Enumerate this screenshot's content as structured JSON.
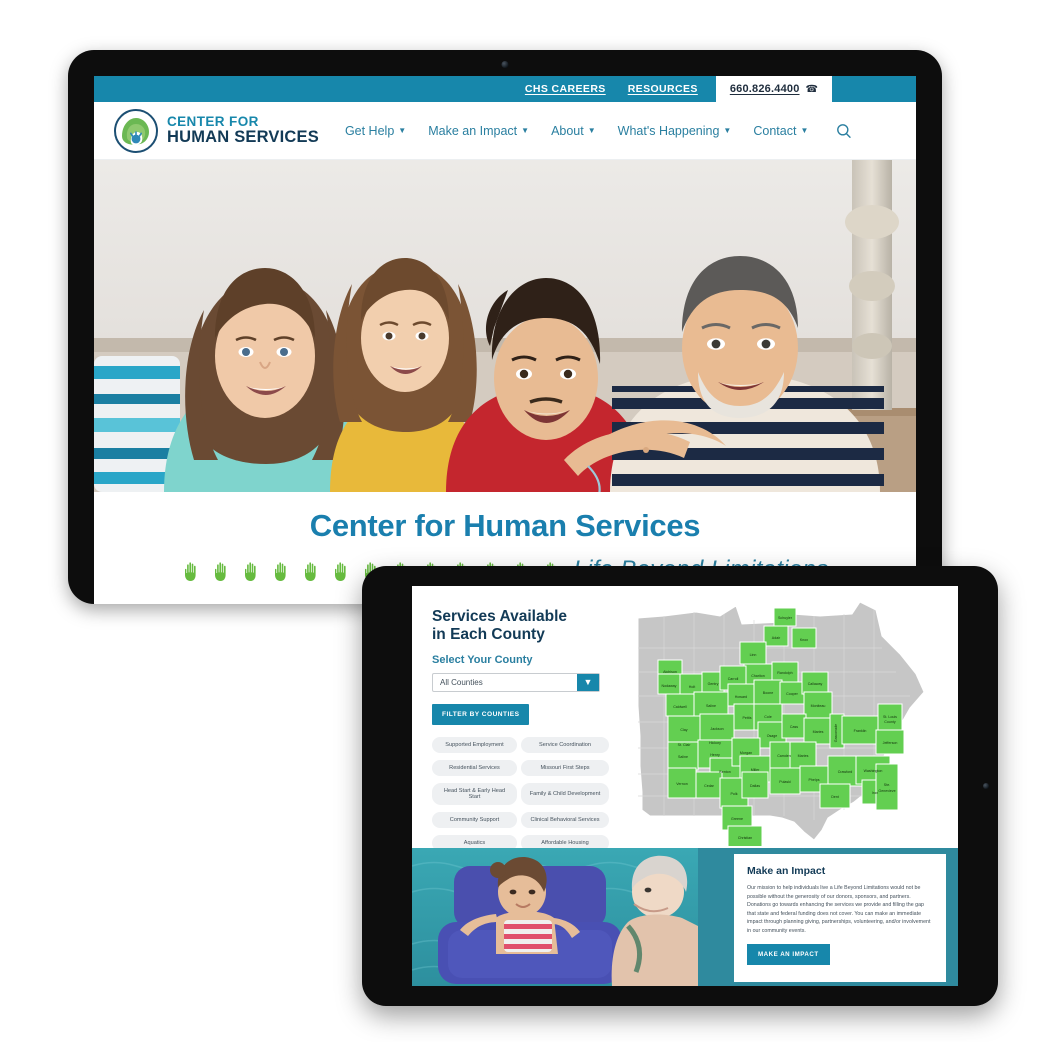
{
  "site": {
    "topbar": {
      "links": [
        {
          "label": "CHS CAREERS"
        },
        {
          "label": "RESOURCES"
        }
      ],
      "phone": "660.826.4400",
      "phone_icon": "phone-icon"
    },
    "logo": {
      "line1": "CENTER FOR",
      "line2": "HUMAN SERVICES",
      "mark": "hands-circle-logo-icon"
    },
    "nav": [
      {
        "label": "Get Help",
        "has_caret": true
      },
      {
        "label": "Make an Impact",
        "has_caret": true
      },
      {
        "label": "About",
        "has_caret": true
      },
      {
        "label": "What's Happening",
        "has_caret": true
      },
      {
        "label": "Contact",
        "has_caret": true
      }
    ],
    "search_icon": "search-icon",
    "hero": {
      "photo_alt": "family-of-four-smiling-on-couch",
      "title": "Center for Human Services",
      "tagline": "Life Beyond Limitations",
      "hand_icon_count": 13,
      "hand_icon": "green-hand-icon"
    }
  },
  "services": {
    "heading_line1": "Services Available",
    "heading_line2": "in Each County",
    "subheading": "Select Your County",
    "select": {
      "value": "All Counties",
      "chevron_icon": "chevron-down-icon"
    },
    "filter_button": "FILTER BY COUNTIES",
    "tags": [
      "Supported Employment",
      "Service Coordination",
      "Residential Services",
      "Missouri First Steps",
      "Head Start & Early Head Start",
      "Family & Child Development",
      "Community Support",
      "Clinical Behavioral Services",
      "Aquatics",
      "Affordable Housing"
    ],
    "map": {
      "alt": "missouri-county-map",
      "base_color": "#c6c6c6",
      "highlight_color": "#63cf51",
      "counties": [
        "Schuyler",
        "Adair",
        "Knox",
        "Linn",
        "Macon",
        "Shelby",
        "Monroe",
        "Audrain",
        "Atchison",
        "Nodaway",
        "Holt",
        "Andrew",
        "Gentry",
        "Worth",
        "Harrison",
        "Caldwell",
        "Carroll",
        "Chariton",
        "Randolph",
        "Saline",
        "Howard",
        "Boone",
        "Cooper",
        "Moniteau",
        "Callaway",
        "Cole",
        "Osage",
        "Gasconade",
        "Franklin",
        "St. Louis County",
        "Jefferson",
        "Miller",
        "Maries",
        "Phelps",
        "Crawford",
        "Washington",
        "Ste. Genevieve",
        "Morgan",
        "Camden",
        "Pulaski",
        "Dent",
        "Iron",
        "Benton",
        "Pettis",
        "Henry",
        "St. Clair",
        "Hickory",
        "Dallas",
        "Laclede",
        "Cedar",
        "Polk",
        "Vernon",
        "Cass",
        "Bates",
        "Greene",
        "Christian"
      ]
    }
  },
  "impact": {
    "photo_alt": "child-on-blue-float-in-pool-with-caregiver",
    "heading": "Make an Impact",
    "body": "Our mission to help individuals live a Life Beyond Limitations would not be possible without the generosity of our donors, sponsors, and partners. Donations go towards enhancing the services we provide and filling the gap that state and federal funding does not cover. You can make an immediate impact through planning giving, partnerships, volunteering, and/or involvement in our community events.",
    "button": "MAKE AN IMPACT"
  },
  "colors": {
    "teal": "#1787ab",
    "navy": "#123a56",
    "hero_blue": "#1a7fae",
    "green": "#63cf51",
    "map_gray": "#c6c6c6"
  }
}
